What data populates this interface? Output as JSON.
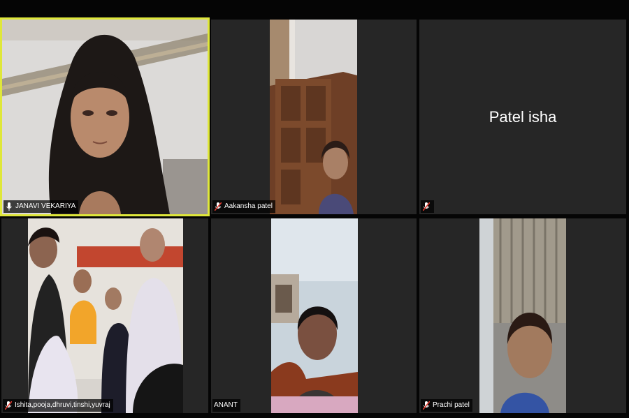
{
  "app": {
    "window": "meeting-gallery-view"
  },
  "colors": {
    "active_speaker_border": "#dfe73a",
    "tile_bg": "#262626",
    "muted_icon": "#e03a2f"
  },
  "participants": [
    {
      "name": "JANAVI VEKARIYA",
      "mic": "mic-icon",
      "active": true
    },
    {
      "name": "Aakansha patel",
      "mic": "muted-mic-icon"
    },
    {
      "name": "Patel isha",
      "mic": "muted-mic-icon",
      "video": false
    },
    {
      "name": "Ishita,pooja,dhruvi,tinshi,yuvraj",
      "mic": "muted-mic-icon"
    },
    {
      "name": "ANANT",
      "mic": "none"
    },
    {
      "name": "Prachi patel",
      "mic": "muted-mic-icon"
    }
  ]
}
